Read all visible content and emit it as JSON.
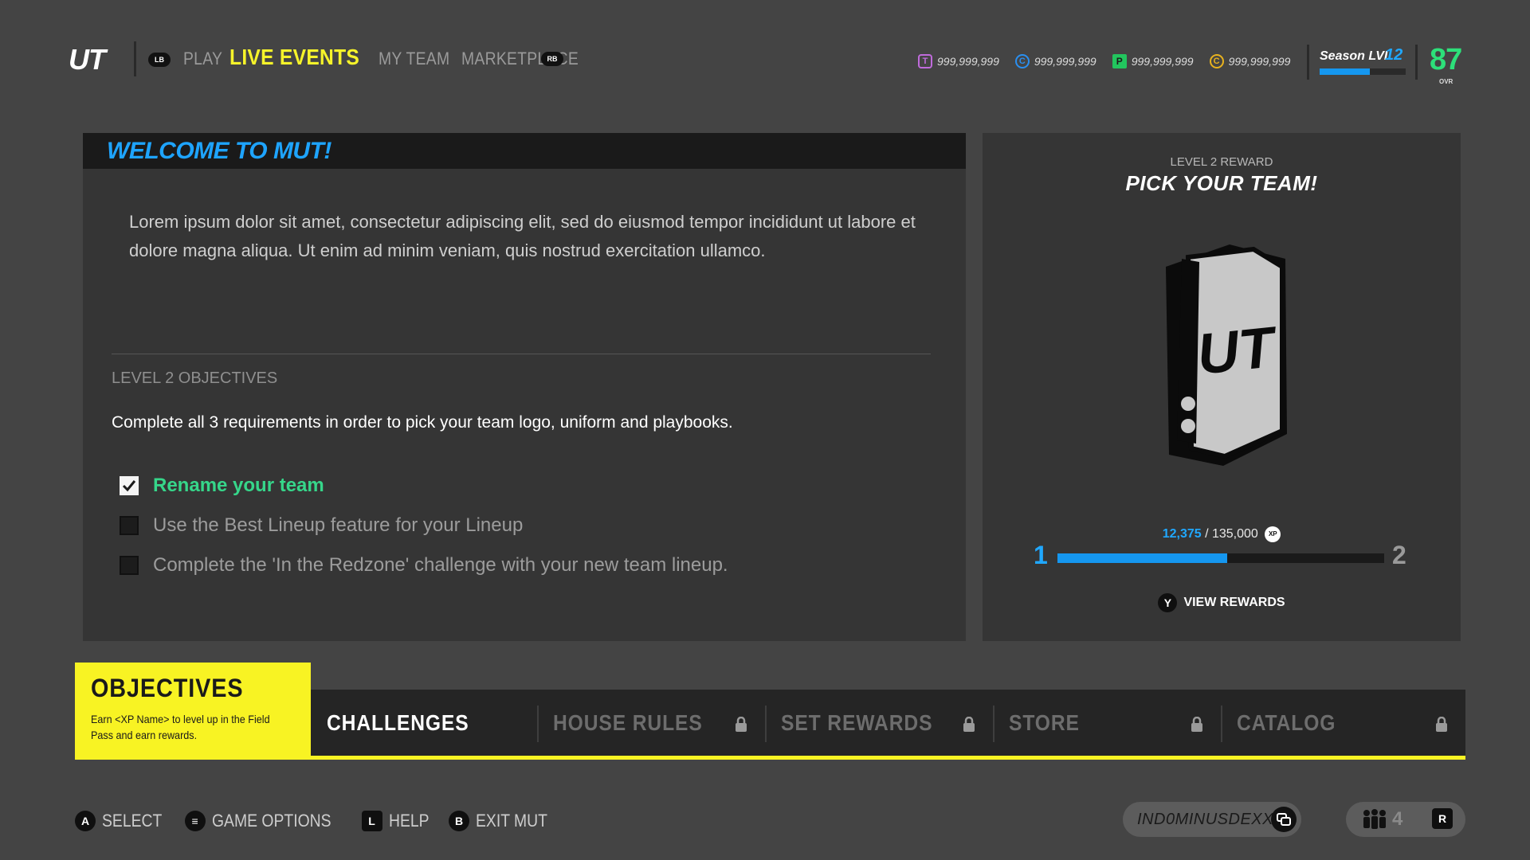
{
  "topbar": {
    "logo": "UT",
    "lb_label": "LB",
    "rb_label": "RB",
    "tabs": [
      {
        "label": "PLAY",
        "active": false
      },
      {
        "label": "LIVE EVENTS",
        "active": true
      },
      {
        "label": "MY TEAM",
        "active": false
      },
      {
        "label": "MARKETPLACE",
        "active": false
      }
    ],
    "currencies": [
      {
        "icon": "training-points-icon",
        "glyph": "T",
        "value": "999,999,999",
        "color": "#c06bdc"
      },
      {
        "icon": "credits-icon",
        "glyph": "C",
        "value": "999,999,999",
        "color": "#2a8ff0"
      },
      {
        "icon": "points-icon",
        "glyph": "P",
        "value": "999,999,999",
        "color": "#22c55e"
      },
      {
        "icon": "coins-icon",
        "glyph": "C",
        "value": "999,999,999",
        "color": "#e8b21e"
      }
    ],
    "season": {
      "label": "Season LVL",
      "level": "12",
      "progress": 0.58
    },
    "ovr": {
      "value": "87",
      "label": "OVR"
    }
  },
  "welcome": {
    "title": "WELCOME TO MUT!",
    "body": "Lorem ipsum dolor sit amet, consectetur adipiscing elit, sed do eiusmod tempor incididunt ut labore et dolore magna aliqua.  Ut enim ad minim veniam, quis nostrud exercitation ullamco.",
    "objectives_heading": "LEVEL 2 OBJECTIVES",
    "instructions": "Complete all 3 requirements in order to pick your team logo, uniform and playbooks.",
    "objectives": [
      {
        "label": "Rename your team",
        "done": true
      },
      {
        "label": "Use the Best Lineup feature for your Lineup",
        "done": false
      },
      {
        "label": "Complete the 'In the Redzone' challenge with your new team lineup.",
        "done": false
      }
    ]
  },
  "reward": {
    "kicker": "LEVEL 2 REWARD",
    "title": "PICK YOUR TEAM!",
    "art_text": "UT",
    "xp_current": "12,375",
    "xp_separator": " / ",
    "xp_total": "135,000",
    "xp_badge": "XP",
    "xp_progress": 0.52,
    "level_from": "1",
    "level_to": "2",
    "view_button": "Y",
    "view_label": "VIEW REWARDS"
  },
  "bottom": {
    "objectives_title": "OBJECTIVES",
    "objectives_desc": "Earn <XP Name> to level up in the Field Pass and earn rewards.",
    "tabs": [
      {
        "label": "CHALLENGES",
        "locked": false,
        "active": true
      },
      {
        "label": "HOUSE RULES",
        "locked": true,
        "active": false
      },
      {
        "label": "SET REWARDS",
        "locked": true,
        "active": false
      },
      {
        "label": "STORE",
        "locked": true,
        "active": false
      },
      {
        "label": "CATALOG",
        "locked": true,
        "active": false
      }
    ]
  },
  "footer": {
    "hints": [
      {
        "button": "A",
        "label": "SELECT",
        "icon": "a-button-icon"
      },
      {
        "button": "≡",
        "label": "GAME OPTIONS",
        "icon": "menu-button-icon"
      },
      {
        "button": "L",
        "label": "HELP",
        "icon": "dpad-left-icon"
      },
      {
        "button": "B",
        "label": "EXIT MUT",
        "icon": "b-button-icon"
      }
    ],
    "gamertag": "IND0MINUSDEXXX",
    "squad_count": "4",
    "squad_button": "R"
  }
}
